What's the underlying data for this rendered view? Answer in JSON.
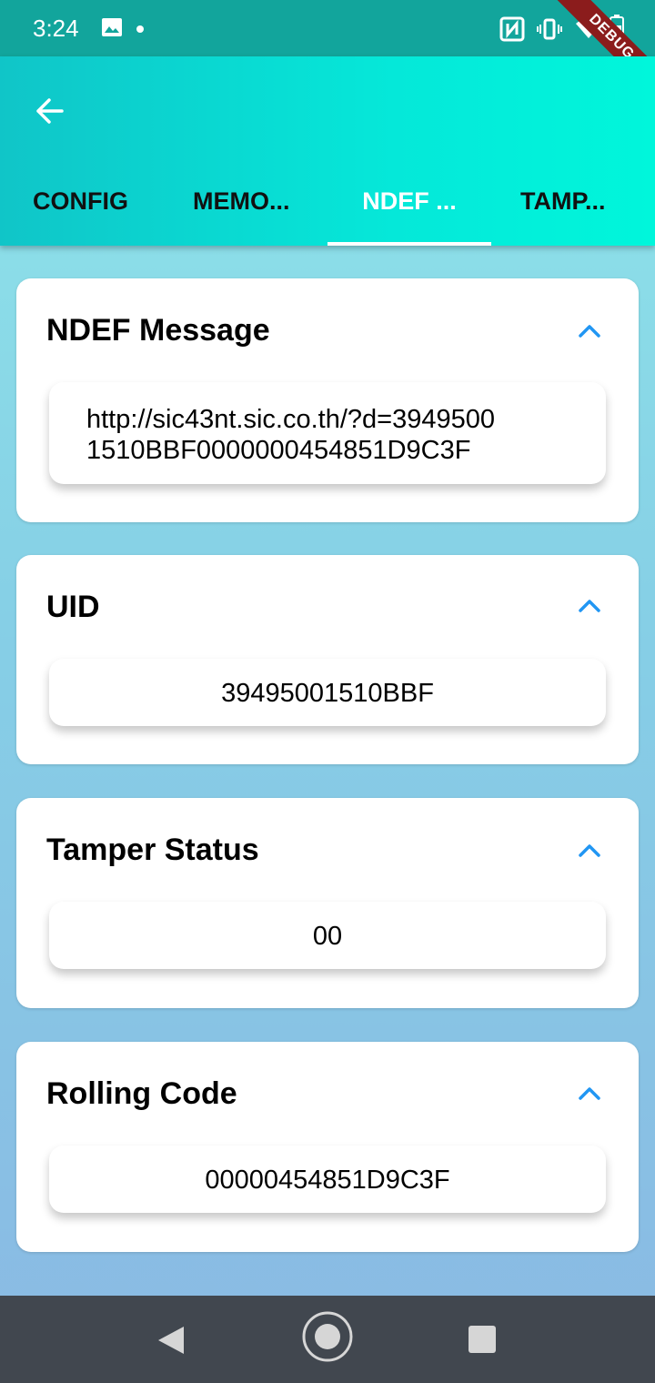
{
  "status_bar": {
    "time": "3:24",
    "debug_label": "DEBUG"
  },
  "tabs": [
    {
      "label": "CONFIG"
    },
    {
      "label": "MEMO..."
    },
    {
      "label": "NDEF ..."
    },
    {
      "label": "TAMP..."
    }
  ],
  "cards": {
    "ndef": {
      "title": "NDEF Message",
      "line1": "http://sic43nt.sic.co.th/?d=3949500",
      "line2": "1510BBF0000000454851D9C3F"
    },
    "uid": {
      "title": "UID",
      "value": "39495001510BBF"
    },
    "tamper": {
      "title": "Tamper Status",
      "value": "00"
    },
    "rolling": {
      "title": "Rolling Code",
      "value": "00000454851D9C3F"
    }
  },
  "colors": {
    "accent": "#2196f3",
    "appbar_start": "#10c5c8",
    "appbar_end": "#00f6db"
  }
}
